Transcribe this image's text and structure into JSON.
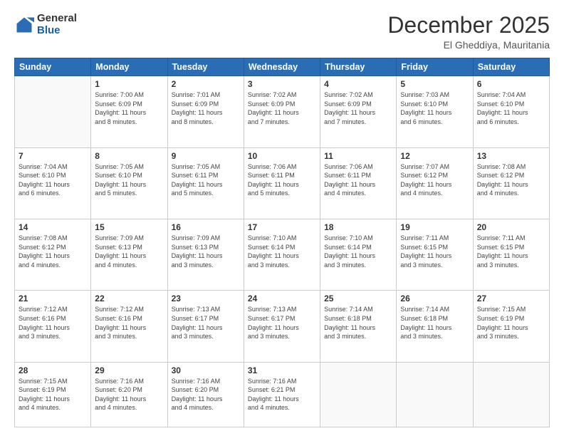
{
  "header": {
    "logo_general": "General",
    "logo_blue": "Blue",
    "month": "December 2025",
    "location": "El Gheddiya, Mauritania"
  },
  "weekdays": [
    "Sunday",
    "Monday",
    "Tuesday",
    "Wednesday",
    "Thursday",
    "Friday",
    "Saturday"
  ],
  "weeks": [
    [
      {
        "day": "",
        "info": ""
      },
      {
        "day": "1",
        "info": "Sunrise: 7:00 AM\nSunset: 6:09 PM\nDaylight: 11 hours\nand 8 minutes."
      },
      {
        "day": "2",
        "info": "Sunrise: 7:01 AM\nSunset: 6:09 PM\nDaylight: 11 hours\nand 8 minutes."
      },
      {
        "day": "3",
        "info": "Sunrise: 7:02 AM\nSunset: 6:09 PM\nDaylight: 11 hours\nand 7 minutes."
      },
      {
        "day": "4",
        "info": "Sunrise: 7:02 AM\nSunset: 6:09 PM\nDaylight: 11 hours\nand 7 minutes."
      },
      {
        "day": "5",
        "info": "Sunrise: 7:03 AM\nSunset: 6:10 PM\nDaylight: 11 hours\nand 6 minutes."
      },
      {
        "day": "6",
        "info": "Sunrise: 7:04 AM\nSunset: 6:10 PM\nDaylight: 11 hours\nand 6 minutes."
      }
    ],
    [
      {
        "day": "7",
        "info": "Sunrise: 7:04 AM\nSunset: 6:10 PM\nDaylight: 11 hours\nand 6 minutes."
      },
      {
        "day": "8",
        "info": "Sunrise: 7:05 AM\nSunset: 6:10 PM\nDaylight: 11 hours\nand 5 minutes."
      },
      {
        "day": "9",
        "info": "Sunrise: 7:05 AM\nSunset: 6:11 PM\nDaylight: 11 hours\nand 5 minutes."
      },
      {
        "day": "10",
        "info": "Sunrise: 7:06 AM\nSunset: 6:11 PM\nDaylight: 11 hours\nand 5 minutes."
      },
      {
        "day": "11",
        "info": "Sunrise: 7:06 AM\nSunset: 6:11 PM\nDaylight: 11 hours\nand 4 minutes."
      },
      {
        "day": "12",
        "info": "Sunrise: 7:07 AM\nSunset: 6:12 PM\nDaylight: 11 hours\nand 4 minutes."
      },
      {
        "day": "13",
        "info": "Sunrise: 7:08 AM\nSunset: 6:12 PM\nDaylight: 11 hours\nand 4 minutes."
      }
    ],
    [
      {
        "day": "14",
        "info": "Sunrise: 7:08 AM\nSunset: 6:12 PM\nDaylight: 11 hours\nand 4 minutes."
      },
      {
        "day": "15",
        "info": "Sunrise: 7:09 AM\nSunset: 6:13 PM\nDaylight: 11 hours\nand 4 minutes."
      },
      {
        "day": "16",
        "info": "Sunrise: 7:09 AM\nSunset: 6:13 PM\nDaylight: 11 hours\nand 3 minutes."
      },
      {
        "day": "17",
        "info": "Sunrise: 7:10 AM\nSunset: 6:14 PM\nDaylight: 11 hours\nand 3 minutes."
      },
      {
        "day": "18",
        "info": "Sunrise: 7:10 AM\nSunset: 6:14 PM\nDaylight: 11 hours\nand 3 minutes."
      },
      {
        "day": "19",
        "info": "Sunrise: 7:11 AM\nSunset: 6:15 PM\nDaylight: 11 hours\nand 3 minutes."
      },
      {
        "day": "20",
        "info": "Sunrise: 7:11 AM\nSunset: 6:15 PM\nDaylight: 11 hours\nand 3 minutes."
      }
    ],
    [
      {
        "day": "21",
        "info": "Sunrise: 7:12 AM\nSunset: 6:16 PM\nDaylight: 11 hours\nand 3 minutes."
      },
      {
        "day": "22",
        "info": "Sunrise: 7:12 AM\nSunset: 6:16 PM\nDaylight: 11 hours\nand 3 minutes."
      },
      {
        "day": "23",
        "info": "Sunrise: 7:13 AM\nSunset: 6:17 PM\nDaylight: 11 hours\nand 3 minutes."
      },
      {
        "day": "24",
        "info": "Sunrise: 7:13 AM\nSunset: 6:17 PM\nDaylight: 11 hours\nand 3 minutes."
      },
      {
        "day": "25",
        "info": "Sunrise: 7:14 AM\nSunset: 6:18 PM\nDaylight: 11 hours\nand 3 minutes."
      },
      {
        "day": "26",
        "info": "Sunrise: 7:14 AM\nSunset: 6:18 PM\nDaylight: 11 hours\nand 3 minutes."
      },
      {
        "day": "27",
        "info": "Sunrise: 7:15 AM\nSunset: 6:19 PM\nDaylight: 11 hours\nand 3 minutes."
      }
    ],
    [
      {
        "day": "28",
        "info": "Sunrise: 7:15 AM\nSunset: 6:19 PM\nDaylight: 11 hours\nand 4 minutes."
      },
      {
        "day": "29",
        "info": "Sunrise: 7:16 AM\nSunset: 6:20 PM\nDaylight: 11 hours\nand 4 minutes."
      },
      {
        "day": "30",
        "info": "Sunrise: 7:16 AM\nSunset: 6:20 PM\nDaylight: 11 hours\nand 4 minutes."
      },
      {
        "day": "31",
        "info": "Sunrise: 7:16 AM\nSunset: 6:21 PM\nDaylight: 11 hours\nand 4 minutes."
      },
      {
        "day": "",
        "info": ""
      },
      {
        "day": "",
        "info": ""
      },
      {
        "day": "",
        "info": ""
      }
    ]
  ]
}
